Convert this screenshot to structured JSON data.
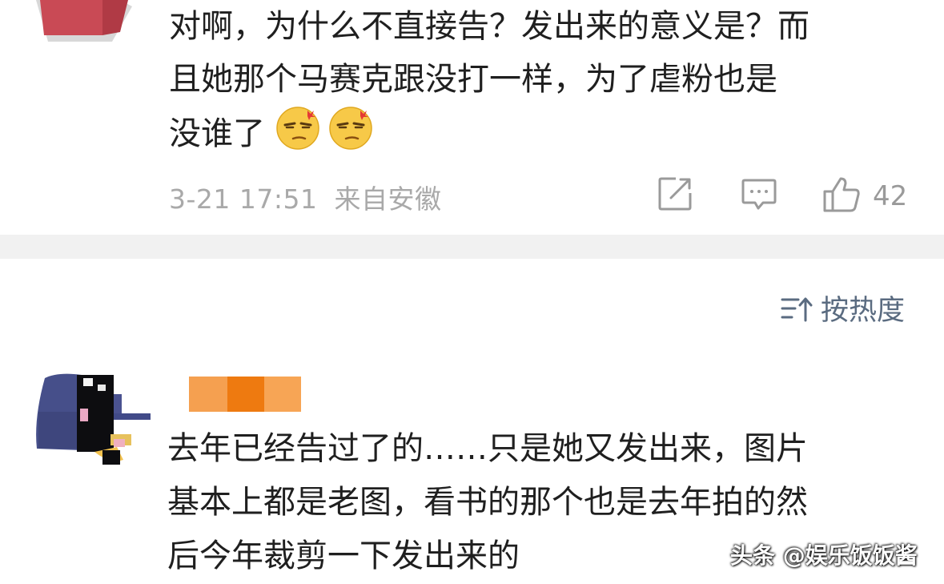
{
  "comments": [
    {
      "lines": [
        "对啊，为什么不直接告？发出来的意义是？而",
        "且她那个马赛克跟没打一样，为了虐粉也是",
        "没谁了"
      ],
      "emojis": [
        "smirk-angry-emoji",
        "smirk-angry-emoji"
      ],
      "time": "3-21 17:51",
      "location": "来自安徽",
      "actions": {
        "share_icon": "share-icon",
        "comment_icon": "comment-icon",
        "like_icon": "thumbs-up-icon",
        "like_count": "42"
      }
    },
    {
      "lines": [
        "去年已经告过了的……只是她又发出来，图片",
        "基本上都是老图，看书的那个也是去年拍的然",
        "后今年裁剪一下发出来的"
      ]
    }
  ],
  "sort": {
    "icon": "sort-icon",
    "label": "按热度"
  },
  "watermark": "头条 @娱乐饭饭酱",
  "colors": {
    "meta_gray": "#a9a9a9",
    "sort_blue": "#5a6b80",
    "separator": "#f1f1f1",
    "username_mosaic": [
      "#f5a050",
      "#ee7a10",
      "#f7a555"
    ]
  }
}
